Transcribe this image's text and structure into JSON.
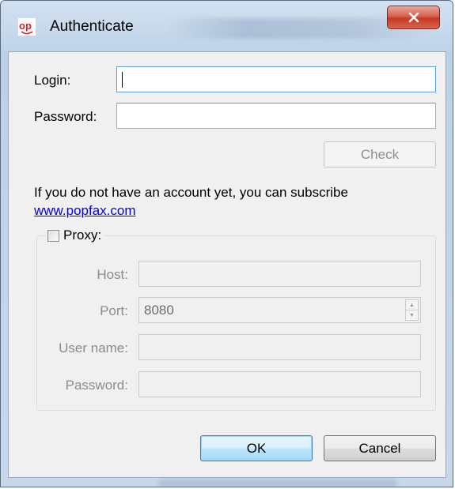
{
  "window": {
    "title": "Authenticate",
    "icon": "popfax-logo-icon"
  },
  "login": {
    "label": "Login:",
    "value": "",
    "focused": true
  },
  "password": {
    "label": "Password:",
    "value": ""
  },
  "check_button": {
    "label": "Check",
    "enabled": false
  },
  "subscribe": {
    "text": "If you do not have an account yet, you can subscribe",
    "link": "www.popfax.com"
  },
  "proxy": {
    "label": "Proxy:",
    "checked": false,
    "host": {
      "label": "Host:",
      "value": ""
    },
    "port": {
      "label": "Port:",
      "value": "8080"
    },
    "username": {
      "label": "User name:",
      "value": ""
    },
    "password": {
      "label": "Password:",
      "value": ""
    }
  },
  "footer": {
    "ok_label": "OK",
    "cancel_label": "Cancel"
  },
  "colors": {
    "accent": "#3c7fb1",
    "close_button": "#c33a22",
    "link": "#0000ee"
  }
}
